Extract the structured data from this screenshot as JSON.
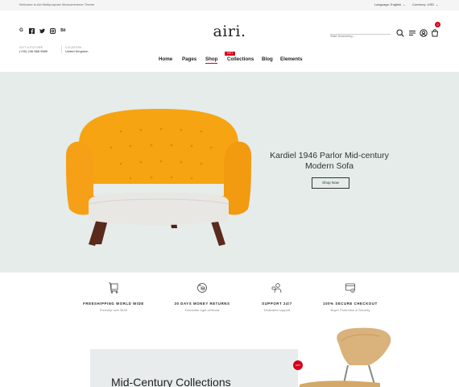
{
  "topbar": {
    "welcome": "Welcome to Airi Multipurpose Woocommerce Theme",
    "language_label": "Language: English",
    "currency_label": "Currency: USD"
  },
  "header": {
    "logo": "airi.",
    "search_placeholder": "Start Searching...",
    "cart_count": "0",
    "contact": {
      "phone_label": "GOT A FUTURE",
      "phone_value": "(+00) 246 868 9889",
      "location_label": "LOCATION",
      "location_value": "United Kingdom"
    },
    "social_icons": [
      "google-plus-icon",
      "facebook-icon",
      "twitter-icon",
      "instagram-icon",
      "behance-icon"
    ]
  },
  "nav": {
    "items": [
      "Home",
      "Pages",
      "Shop",
      "Collections",
      "Blog",
      "Elements"
    ],
    "hot_badge": "HOT",
    "active": "Shop"
  },
  "hero": {
    "title_line1": "Kardiel 1946 Parlor Mid-century",
    "title_line2": "Modern Sofa",
    "button": "Shop Now",
    "background_color": "#e5ecea",
    "sofa_color": "#f5a31a"
  },
  "features": [
    {
      "title": "FREESHIPPING WORLD WIDE",
      "subtitle": "Freeship over $150",
      "icon": "delivery-icon"
    },
    {
      "title": "30 DAYS MONEY RETURNS",
      "subtitle": "Dondottur eget vehicula",
      "icon": "money-return-icon"
    },
    {
      "title": "SUPPORT 24/7",
      "subtitle": "Dedicated support",
      "icon": "support-icon"
    },
    {
      "title": "100% SECURE CHECKOUT",
      "subtitle": "Buyer Protection & Security",
      "icon": "secure-checkout-icon"
    }
  ],
  "promo": {
    "title": "Mid-Century Collections",
    "badge": "HOT"
  },
  "colors": {
    "accent": "#d0011b"
  }
}
